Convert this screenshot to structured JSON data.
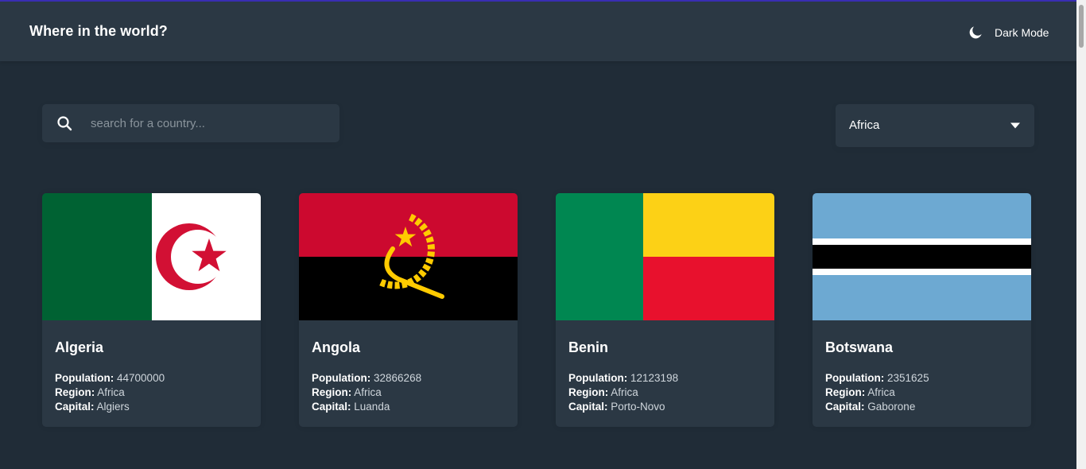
{
  "header": {
    "title": "Where in the world?",
    "mode_label": "Dark Mode",
    "mode_icon": "moon-icon"
  },
  "search": {
    "placeholder": "search for a country...",
    "value": "",
    "icon": "search-icon"
  },
  "filter": {
    "selected": "Africa",
    "icon": "chevron-down-icon"
  },
  "labels": {
    "population": "Population:",
    "region": "Region:",
    "capital": "Capital:"
  },
  "countries": [
    {
      "name": "Algeria",
      "population": "44700000",
      "region": "Africa",
      "capital": "Algiers"
    },
    {
      "name": "Angola",
      "population": "32866268",
      "region": "Africa",
      "capital": "Luanda"
    },
    {
      "name": "Benin",
      "population": "12123198",
      "region": "Africa",
      "capital": "Porto-Novo"
    },
    {
      "name": "Botswana",
      "population": "2351625",
      "region": "Africa",
      "capital": "Gaborone"
    }
  ],
  "colors": {
    "background": "#202c37",
    "element": "#2b3844",
    "text": "#ffffff"
  }
}
